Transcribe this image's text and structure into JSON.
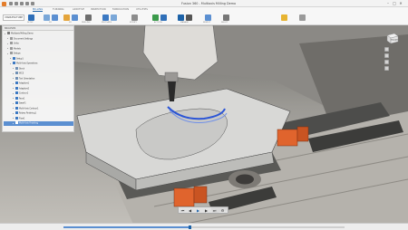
{
  "window": {
    "title": "Fusion 360 - Multiaxis Milling Demo",
    "controls": [
      "–",
      "□",
      "✕"
    ],
    "quick_access_icons": [
      "grid-menu-icon",
      "file-icon",
      "save-icon",
      "undo-icon",
      "redo-icon"
    ]
  },
  "ribbon": {
    "tabs": [
      {
        "label": "MILLING",
        "active": true
      },
      {
        "label": "TURNING",
        "active": false
      },
      {
        "label": "ADDITIVE",
        "active": false
      },
      {
        "label": "INSPECTION",
        "active": false
      },
      {
        "label": "FABRICATION",
        "active": false
      },
      {
        "label": "UTILITIES",
        "active": false
      }
    ],
    "workspace": "MANUFACTURE",
    "groups": [
      {
        "label": "SETUP"
      },
      {
        "label": "2D"
      },
      {
        "label": "3D"
      },
      {
        "label": "DRILLING"
      },
      {
        "label": "MULTI-AXIS"
      },
      {
        "label": "MODIFY"
      },
      {
        "label": "ACTIONS"
      },
      {
        "label": "MANAGE"
      },
      {
        "label": "INSPECT"
      },
      {
        "label": "SELECT"
      }
    ]
  },
  "browser": {
    "header": "BROWSER",
    "rows": [
      {
        "label": "Multiaxis Milling Demo",
        "indent": 0,
        "icon_color": "#7a7a7a",
        "selected": false
      },
      {
        "label": "Document Settings",
        "indent": 1,
        "icon_color": "#9a9a9a",
        "selected": false
      },
      {
        "label": "Units",
        "indent": 1,
        "icon_color": "#9a9a9a",
        "selected": false
      },
      {
        "label": "Models",
        "indent": 1,
        "icon_color": "#9a9a9a",
        "selected": false
      },
      {
        "label": "Setups",
        "indent": 1,
        "icon_color": "#9a9a9a",
        "selected": false
      },
      {
        "label": "Setup1",
        "indent": 2,
        "icon_color": "#3b78c2",
        "selected": false
      },
      {
        "label": "Multi-Axis Operations",
        "indent": 2,
        "icon_color": "#3b78c2",
        "selected": false
      },
      {
        "label": "Stock",
        "indent": 3,
        "icon_color": "#6f8fb4",
        "selected": false
      },
      {
        "label": "WCS",
        "indent": 3,
        "icon_color": "#6f8fb4",
        "selected": false
      },
      {
        "label": "Tool Orientation",
        "indent": 3,
        "icon_color": "#6f8fb4",
        "selected": false
      },
      {
        "label": "Adaptive1",
        "indent": 3,
        "icon_color": "#3b78c2",
        "selected": false
      },
      {
        "label": "Adaptive2",
        "indent": 3,
        "icon_color": "#3b78c2",
        "selected": false
      },
      {
        "label": "Contour1",
        "indent": 3,
        "icon_color": "#3b78c2",
        "selected": false
      },
      {
        "label": "Face1",
        "indent": 3,
        "icon_color": "#3b78c2",
        "selected": false
      },
      {
        "label": "Swarf1",
        "indent": 3,
        "icon_color": "#3b78c2",
        "selected": false
      },
      {
        "label": "Multi-Axis Contour1",
        "indent": 3,
        "icon_color": "#3b78c2",
        "selected": false
      },
      {
        "label": "Rotary Finishing1",
        "indent": 3,
        "icon_color": "#3b78c2",
        "selected": false
      },
      {
        "label": "Flow1",
        "indent": 3,
        "icon_color": "#3b78c2",
        "selected": false
      },
      {
        "label": "Multi-Axis Finishing",
        "indent": 3,
        "icon_color": "#ffffff",
        "selected": true
      }
    ]
  },
  "viewcube": {
    "label": "FRONT"
  },
  "playback": {
    "buttons": [
      {
        "name": "skip-start-icon",
        "glyph": "⏮"
      },
      {
        "name": "step-back-icon",
        "glyph": "◀"
      },
      {
        "name": "play-icon",
        "glyph": "▶"
      },
      {
        "name": "step-forward-icon",
        "glyph": "▶"
      },
      {
        "name": "skip-end-icon",
        "glyph": "⏭"
      },
      {
        "name": "settings-icon",
        "glyph": "⚙"
      }
    ],
    "progress": 0.45
  },
  "colors": {
    "accent": "#1c62a8",
    "selection": "#5b8fd1",
    "fixture_orange": "#e0642d",
    "toolpath_blue": "#2b55d6",
    "part_gray": "#d8d8d6"
  }
}
